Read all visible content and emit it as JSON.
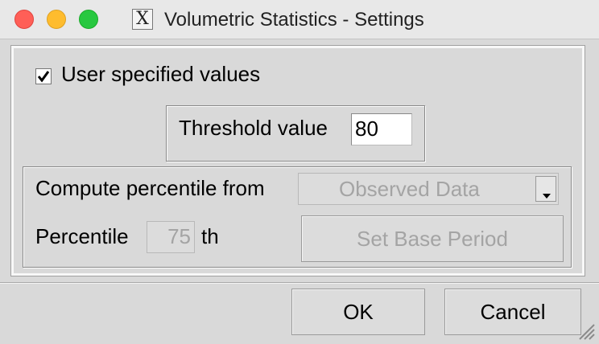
{
  "window": {
    "title": "Volumetric Statistics - Settings",
    "app_icon_glyph": "X",
    "icons": [
      "close-icon",
      "minimize-icon",
      "zoom-icon",
      "x11-app-icon",
      "checkmark-icon",
      "chevron-down-icon",
      "resize-grip-icon"
    ],
    "colors": {
      "close": "#ff5f57",
      "minimize": "#febc2e",
      "zoom": "#28c840",
      "background": "#d9d9d9",
      "disabled_text": "#a4a4a4"
    }
  },
  "user_values": {
    "label": "User specified values",
    "checked": true
  },
  "threshold": {
    "label": "Threshold value",
    "value": "80"
  },
  "percentile_section": {
    "compute_label": "Compute percentile from",
    "source_selected": "Observed Data",
    "percentile_label": "Percentile",
    "percentile_value": "75",
    "percentile_suffix": "th",
    "base_period_label": "Set Base Period",
    "disabled": true
  },
  "buttons": {
    "ok": "OK",
    "cancel": "Cancel"
  }
}
